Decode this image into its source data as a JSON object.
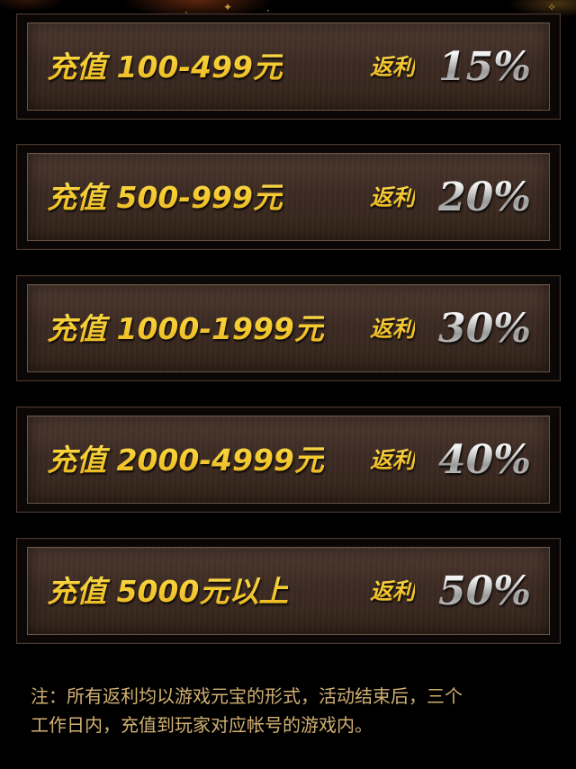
{
  "tiers": [
    {
      "range": "充值 100-499元",
      "rebate_label": "返利",
      "rate": "15%"
    },
    {
      "range": "充值 500-999元",
      "rebate_label": "返利",
      "rate": "20%"
    },
    {
      "range": "充值 1000-1999元",
      "rebate_label": "返利",
      "rate": "30%"
    },
    {
      "range": "充值 2000-4999元",
      "rebate_label": "返利",
      "rate": "40%"
    },
    {
      "range": "充值 5000元以上",
      "rebate_label": "返利",
      "rate": "50%"
    }
  ],
  "note": {
    "line1": "注：所有返利均以游戏元宝的形式，活动结束后，三个",
    "line2": "工作日内，充值到玩家对应帐号的游戏内。"
  },
  "colors": {
    "background": "#000000",
    "gold_text": "#f2c323",
    "silver_text": "#e6e6e6",
    "note_text": "#d2b072",
    "panel_brown": "#3c2b23"
  }
}
